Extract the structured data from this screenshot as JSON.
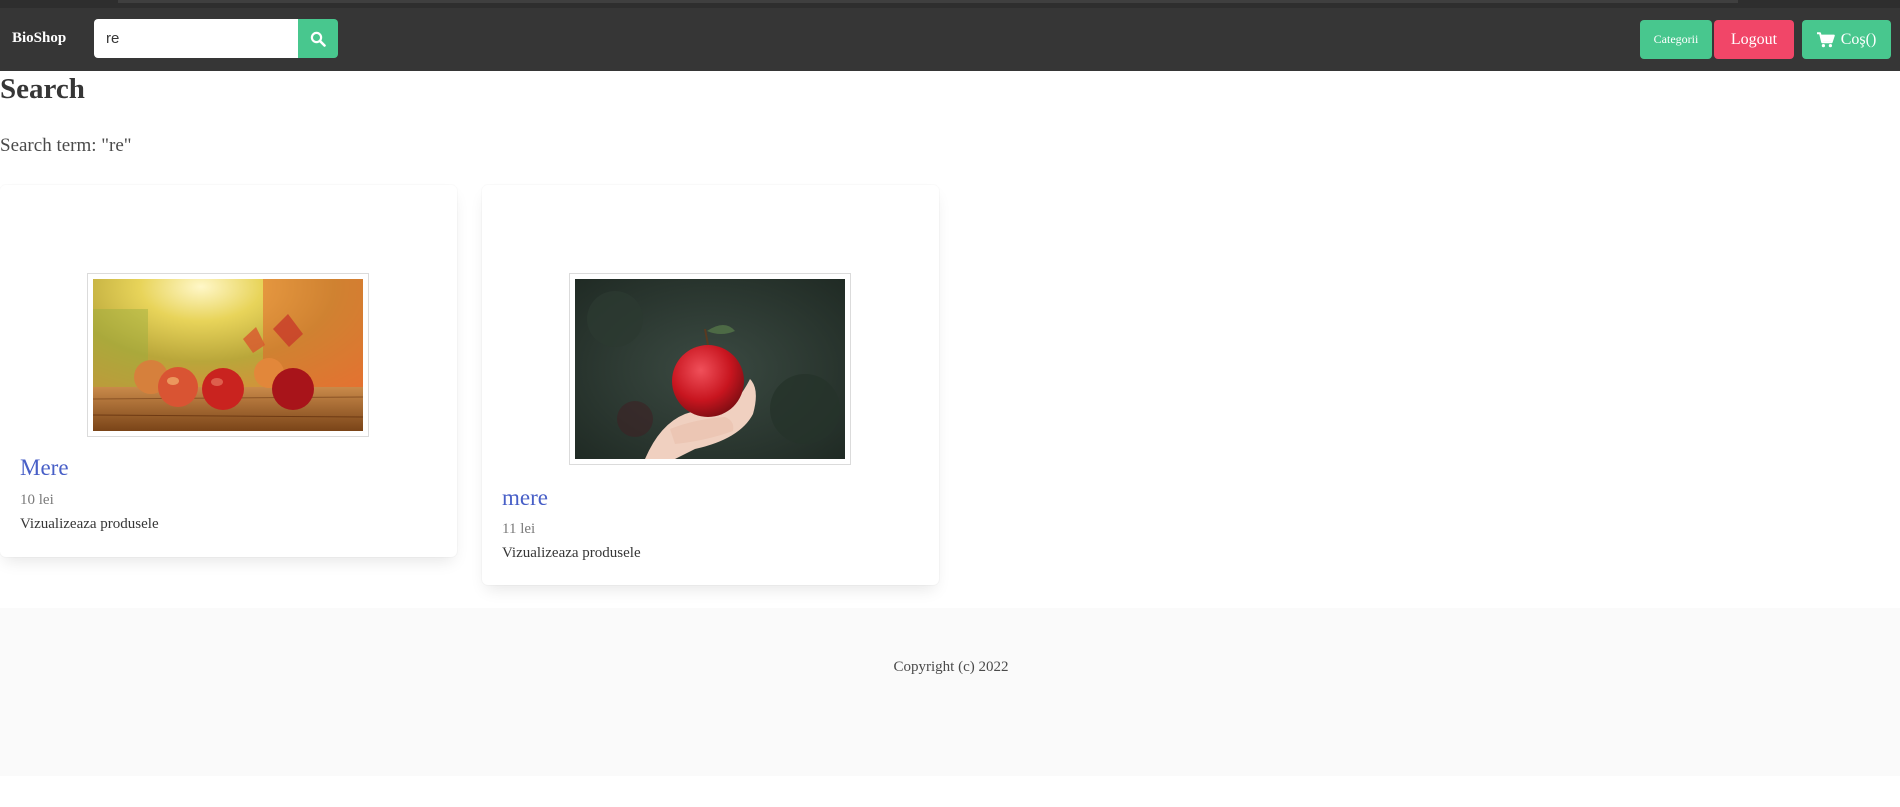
{
  "navbar": {
    "brand": "BioShop",
    "search_value": "re",
    "categories_label": "Categorii",
    "logout_label": "Logout",
    "cart_label": "Coş()"
  },
  "page": {
    "title": "Search",
    "subtitle": "Search term: \"re\""
  },
  "products": [
    {
      "name": "Mere",
      "price": "10 lei",
      "link": "Vizualizeaza produsele"
    },
    {
      "name": "mere",
      "price": "11 lei",
      "link": "Vizualizeaza produsele"
    }
  ],
  "footer": {
    "copyright": "Copyright (c) 2022"
  },
  "colors": {
    "navbar": "#363636",
    "primary_green": "#48c78e",
    "danger_pink": "#f14668",
    "link_blue": "#485fc7",
    "footer_bg": "#fafafa"
  },
  "icons": [
    "search-icon",
    "cart-icon"
  ]
}
